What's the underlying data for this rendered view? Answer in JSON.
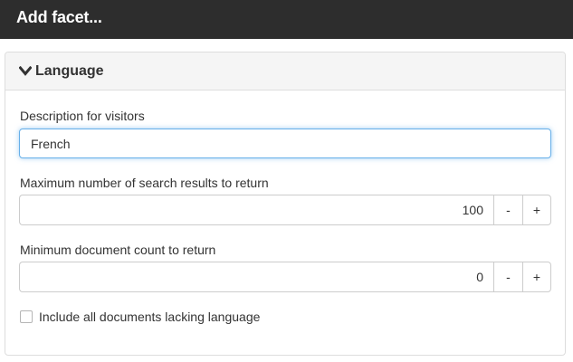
{
  "header": {
    "title": "Add facet..."
  },
  "facet": {
    "name": "Language",
    "description_label": "Description for visitors",
    "description_value": "French",
    "max_results_label": "Maximum number of search results to return",
    "max_results_value": "100",
    "min_count_label": "Minimum document count to return",
    "min_count_value": "0",
    "decrement_label": "-",
    "increment_label": "+",
    "include_missing_label": "Include all documents lacking language",
    "include_missing_checked": false
  },
  "colors": {
    "topbar": "#2d2d2d",
    "panel_heading": "#f5f5f5",
    "focus_border": "#66afe9",
    "border": "#cccccc"
  },
  "icons": {
    "collapse": "chevron-down-icon"
  }
}
